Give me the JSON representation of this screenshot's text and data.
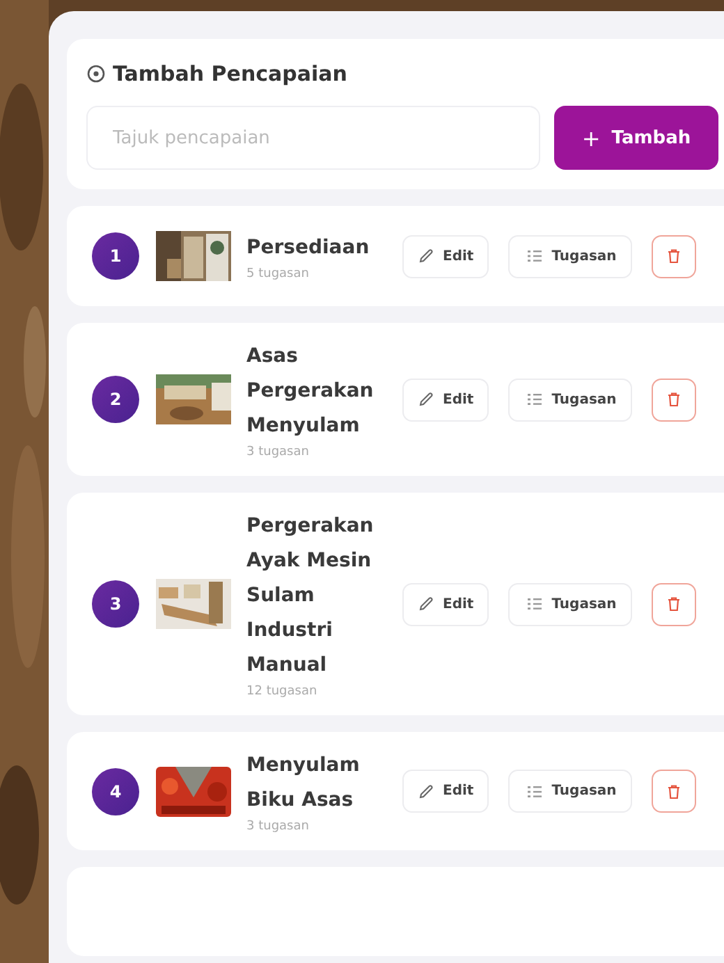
{
  "form": {
    "title": "Tambah Pencapaian",
    "input": {
      "placeholder": "Tajuk pencapaian"
    },
    "add_button": {
      "icon": "+",
      "label": "Tambah"
    }
  },
  "achievements": [
    {
      "number": "1",
      "title": "Persediaan",
      "task_count": "5 tugasan",
      "edit_label": "Edit",
      "tasks_label": "Tugasan"
    },
    {
      "number": "2",
      "title": "Asas Pergerakan Menyulam",
      "task_count": "3 tugasan",
      "edit_label": "Edit",
      "tasks_label": "Tugasan"
    },
    {
      "number": "3",
      "title": "Pergerakan Ayak Mesin Sulam Industri Manual",
      "task_count": "12 tugasan",
      "edit_label": "Edit",
      "tasks_label": "Tugasan"
    },
    {
      "number": "4",
      "title": "Menyulam Biku Asas",
      "task_count": "3 tugasan",
      "edit_label": "Edit",
      "tasks_label": "Tugasan"
    }
  ]
}
